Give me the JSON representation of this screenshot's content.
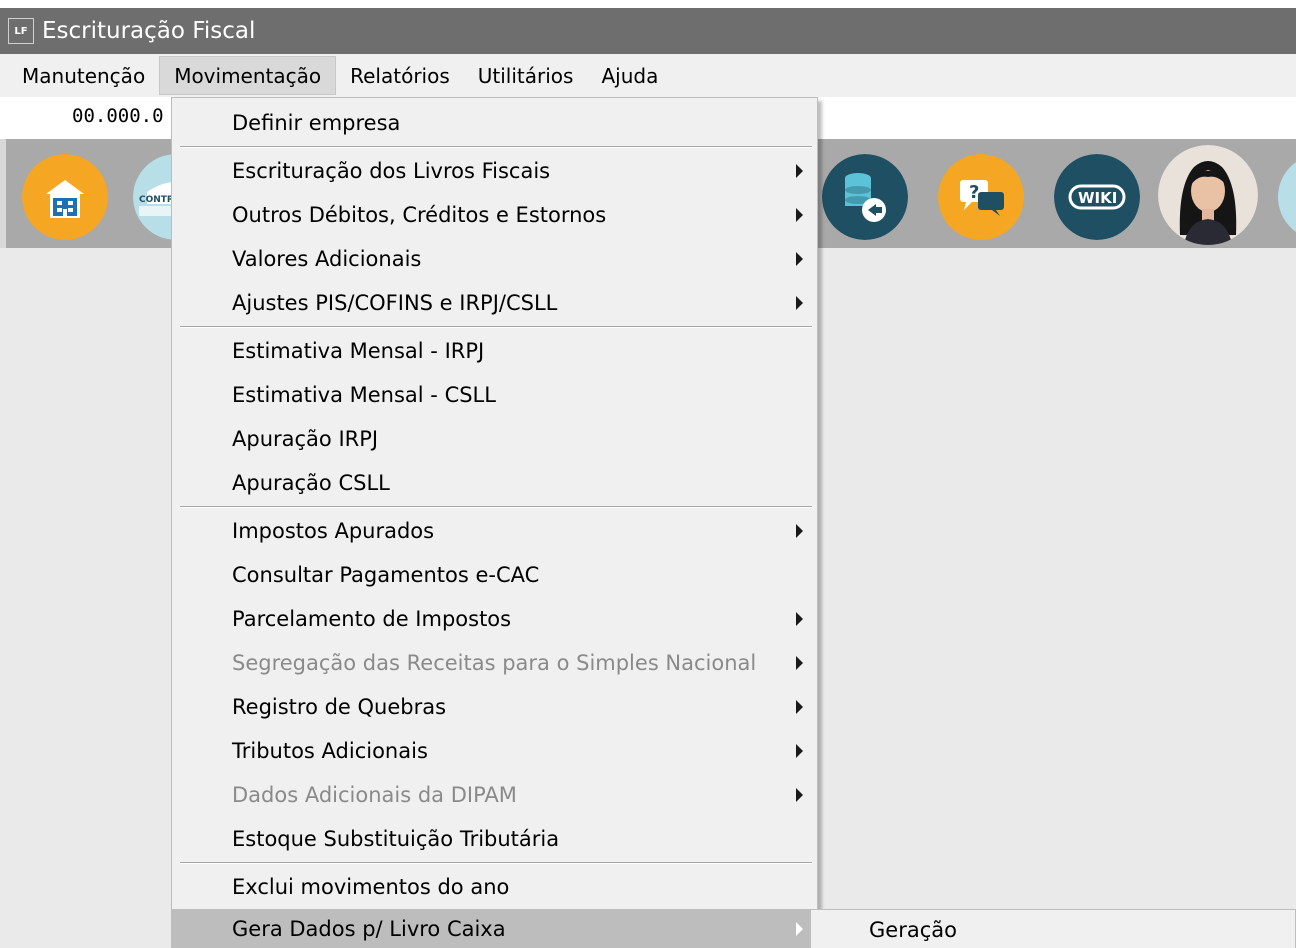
{
  "window": {
    "app_icon_text": "LF",
    "title": "Escrituração Fiscal"
  },
  "menubar": {
    "items": [
      {
        "label": "Manutenção"
      },
      {
        "label": "Movimentação"
      },
      {
        "label": "Relatórios"
      },
      {
        "label": "Utilitários"
      },
      {
        "label": "Ajuda"
      }
    ]
  },
  "company": {
    "code": "00.000.0"
  },
  "toolbar": {
    "cont_label": "CONTR",
    "wiki_label": "WIKI",
    "colors": {
      "orange": "#f5a623",
      "teal": "#1e4f63",
      "light_teal": "#b8dfe8"
    }
  },
  "menu": {
    "items": [
      {
        "label": "Definir empresa"
      },
      {
        "label": "Escrituração dos Livros Fiscais"
      },
      {
        "label": "Outros Débitos, Créditos e Estornos"
      },
      {
        "label": "Valores Adicionais"
      },
      {
        "label": "Ajustes PIS/COFINS e IRPJ/CSLL"
      },
      {
        "label": "Estimativa Mensal - IRPJ"
      },
      {
        "label": "Estimativa Mensal - CSLL"
      },
      {
        "label": "Apuração IRPJ"
      },
      {
        "label": "Apuração CSLL"
      },
      {
        "label": "Impostos Apurados"
      },
      {
        "label": "Consultar Pagamentos e-CAC"
      },
      {
        "label": "Parcelamento de Impostos"
      },
      {
        "label": "Segregação das Receitas para o Simples Nacional"
      },
      {
        "label": "Registro de Quebras"
      },
      {
        "label": "Tributos Adicionais"
      },
      {
        "label": "Dados Adicionais da DIPAM"
      },
      {
        "label": "Estoque Substituição Tributária"
      },
      {
        "label": "Exclui movimentos do ano"
      },
      {
        "label": "Gera Dados p/ Livro Caixa"
      }
    ]
  },
  "submenu": {
    "items": [
      {
        "label": "Geração"
      }
    ]
  }
}
